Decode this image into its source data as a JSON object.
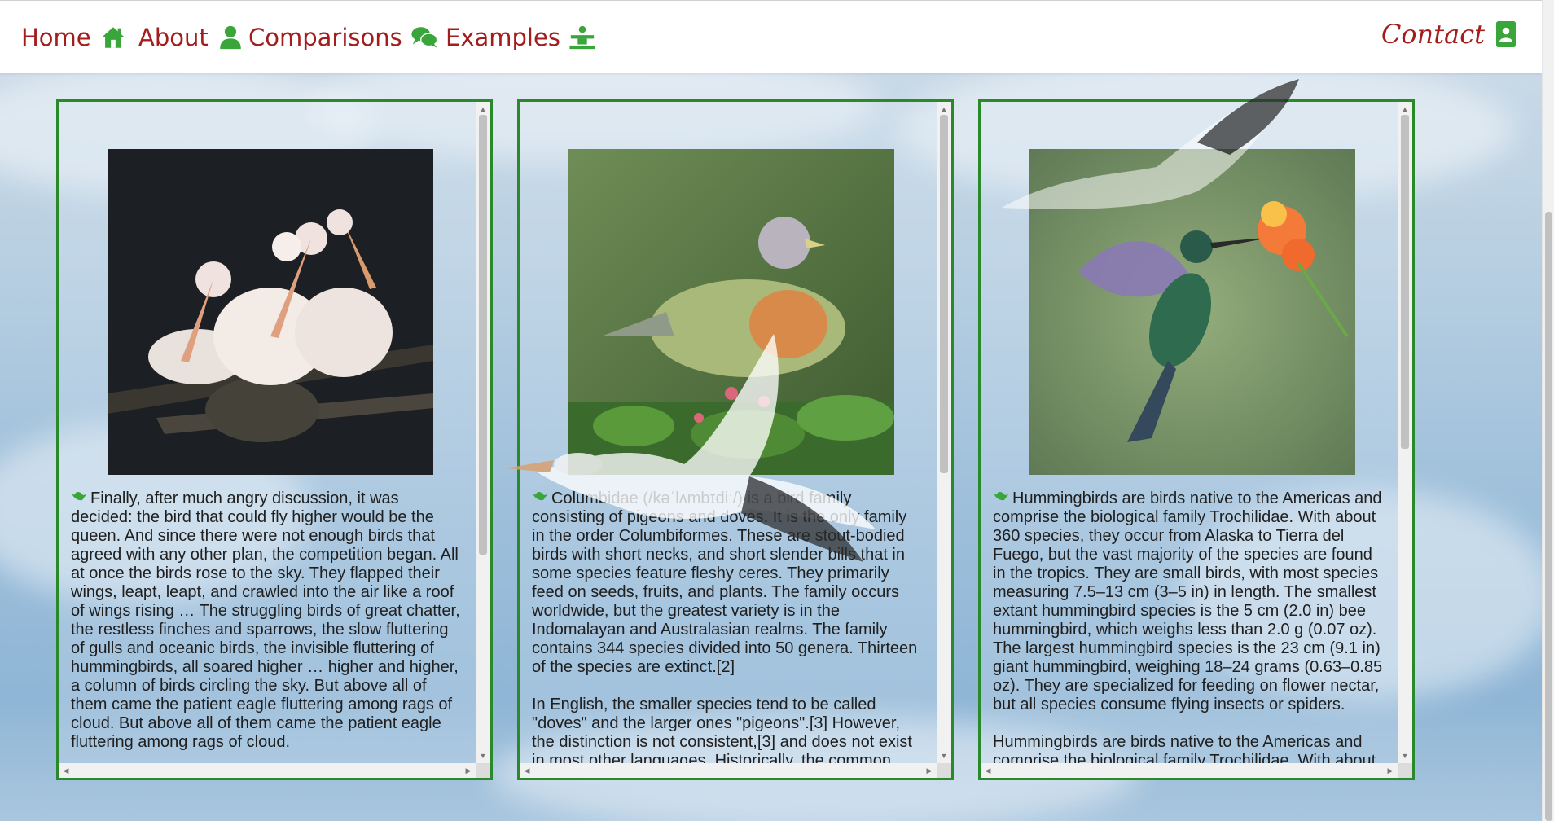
{
  "nav": {
    "home_label": "Home",
    "about_label": "About",
    "comparisons_label": "Comparisons",
    "examples_label": "Examples",
    "contact_label": "Contact"
  },
  "colors": {
    "nav_text": "#a41d1d",
    "nav_icon": "#3aa53a",
    "card_border": "#2a8a2a"
  },
  "cards": [
    {
      "image": "pelicans-photo",
      "paragraphs": [
        "Finally, after much angry discussion, it was decided: the bird that could fly higher would be the queen. And since there were not enough birds that agreed with any other plan, the competition began. All at once the birds rose to the sky. They flapped their wings, leapt, leapt, and crawled into the air like a roof of wings rising … The struggling birds of great chatter, the restless finches and sparrows, the slow fluttering of gulls and oceanic birds, the invisible fluttering of hummingbirds, all soared higher … higher and higher, a column of birds circling the sky. But above all of them came the patient eagle fluttering among rags of cloud. But above all of them came the patient eagle fluttering among rags of cloud."
      ]
    },
    {
      "image": "pigeon-photo",
      "paragraphs": [
        "Columbidae (/kəˈlʌmbɪdiː/) is a bird family consisting of pigeons and doves. It is the only family in the order Columbiformes. These are stout-bodied birds with short necks, and short slender bills that in some species feature fleshy ceres. They primarily feed on seeds, fruits, and plants. The family occurs worldwide, but the greatest variety is in the Indomalayan and Australasian realms. The family contains 344 species divided into 50 genera. Thirteen of the species are extinct.[2]",
        "In English, the smaller species tend to be called \"doves\" and the larger ones \"pigeons\".[3] However, the distinction is not consistent,[3] and does not exist in most other languages. Historically, the common"
      ]
    },
    {
      "image": "hummingbird-photo",
      "paragraphs": [
        "Hummingbirds are birds native to the Americas and comprise the biological family Trochilidae. With about 360 species, they occur from Alaska to Tierra del Fuego, but the vast majority of the species are found in the tropics. They are small birds, with most species measuring 7.5–13 cm (3–5 in) in length. The smallest extant hummingbird species is the 5 cm (2.0 in) bee hummingbird, which weighs less than 2.0 g (0.07 oz). The largest hummingbird species is the 23 cm (9.1 in) giant hummingbird, weighing 18–24 grams (0.63–0.85 oz). They are specialized for feeding on flower nectar, but all species consume flying insects or spiders.",
        "Hummingbirds are birds native to the Americas and comprise the biological family Trochilidae. With about"
      ]
    }
  ]
}
